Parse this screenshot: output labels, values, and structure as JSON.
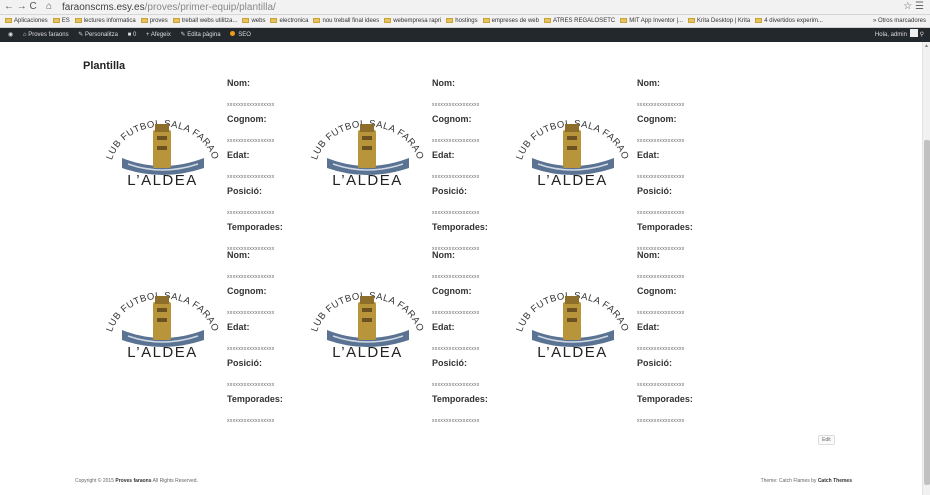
{
  "browser": {
    "url_host": "faraonscms.esy.es",
    "url_path": "/proves/primer-equip/plantilla/",
    "nav_glyphs": "← → C",
    "bookmarks": [
      "Aplicaciones",
      "ES",
      "lectures informatica",
      "proves",
      "treball webs utilitza...",
      "webs",
      "electronica",
      "nou treball final idees",
      "webempresa rapri",
      "hostings",
      "empreses de web",
      "ATRES REGALOSETC",
      "MIT App Inventor |...",
      "Krita Desktop | Krita",
      "4 divertidos experim..."
    ],
    "bookmarks_more": "»  Otros marcadores"
  },
  "admin_bar": {
    "site_name": "Proves faraons",
    "customize": "Personalitza",
    "comments": "0",
    "new": "Afegeix",
    "edit": "Edita pàgina",
    "seo": "SEO",
    "howdy": "Hola, admin"
  },
  "page": {
    "title": "Plantilla"
  },
  "labels": {
    "nom": "Nom:",
    "cognom": "Cognom:",
    "edat": "Edat:",
    "posicio": "Posició:",
    "temporades": "Temporades:"
  },
  "placeholder_value": "xxxxxxxxxxxxxxxxx",
  "logo": {
    "arc_text": "CLUB FUTBOL SALA FARAON",
    "name": "L’ALDEA"
  },
  "players": [
    {
      "nom": "xxxxxxxxxxxxxxxxx",
      "cognom": "xxxxxxxxxxxxxxxxx",
      "edat": "xxxxxxxxxxxxxxxxx",
      "posicio": "xxxxxxxxxxxxxxxxx",
      "temporades": "xxxxxxxxxxxxxxxxx"
    },
    {
      "nom": "xxxxxxxxxxxxxxxxx",
      "cognom": "xxxxxxxxxxxxxxxxx",
      "edat": "xxxxxxxxxxxxxxxxx",
      "posicio": "xxxxxxxxxxxxxxxxx",
      "temporades": "xxxxxxxxxxxxxxxxx"
    },
    {
      "nom": "xxxxxxxxxxxxxxxxx",
      "cognom": "xxxxxxxxxxxxxxxxx",
      "edat": "xxxxxxxxxxxxxxxxx",
      "posicio": "xxxxxxxxxxxxxxxxx",
      "temporades": "xxxxxxxxxxxxxxxxx"
    },
    {
      "nom": "xxxxxxxxxxxxxxxxx",
      "cognom": "xxxxxxxxxxxxxxxxx",
      "edat": "xxxxxxxxxxxxxxxxx",
      "posicio": "xxxxxxxxxxxxxxxxx",
      "temporades": "xxxxxxxxxxxxxxxxx"
    },
    {
      "nom": "xxxxxxxxxxxxxxxxx",
      "cognom": "xxxxxxxxxxxxxxxxx",
      "edat": "xxxxxxxxxxxxxxxxx",
      "posicio": "xxxxxxxxxxxxxxxxx",
      "temporades": "xxxxxxxxxxxxxxxxx"
    },
    {
      "nom": "xxxxxxxxxxxxxxxxx",
      "cognom": "xxxxxxxxxxxxxxxxx",
      "edat": "xxxxxxxxxxxxxxxxx",
      "posicio": "xxxxxxxxxxxxxxxxx",
      "temporades": "xxxxxxxxxxxxxxxxx"
    }
  ],
  "edit_button": "Edit",
  "footer": {
    "copyright_prefix": "Copyright © 2015",
    "site_link": "Proves faraons",
    "rights": "All Rights Reserved.",
    "theme_prefix": "Theme: Catch Flames by",
    "theme_link": "Catch Themes"
  }
}
